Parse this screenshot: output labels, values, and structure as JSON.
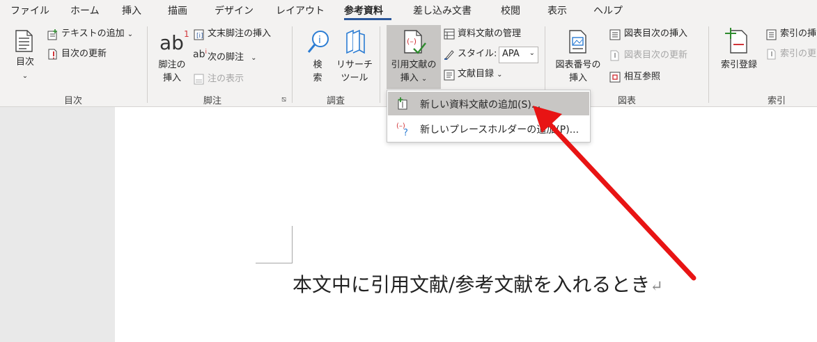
{
  "tabs": [
    "ファイル",
    "ホーム",
    "挿入",
    "描画",
    "デザイン",
    "レイアウト",
    "参考資料",
    "差し込み文書",
    "校閲",
    "表示",
    "ヘルプ"
  ],
  "active_tab": "参考資料",
  "ribbon": {
    "toc": {
      "big_button": "目次",
      "add_text": "テキストの追加",
      "update_toc": "目次の更新",
      "group_label": "目次"
    },
    "footnotes": {
      "insert_footnote_line1": "脚注の",
      "insert_footnote_line2": "挿入",
      "ab_glyph": "ab",
      "superscript": "1",
      "insert_endnote": "文末脚注の挿入",
      "next_footnote": "次の脚注",
      "show_notes": "注の表示",
      "group_label": "脚注"
    },
    "research": {
      "search_line1": "検",
      "search_line2": "索",
      "researcher_line1": "リサーチ",
      "researcher_line2": "ツール",
      "group_label": "調査"
    },
    "citations": {
      "insert_citation_line1": "引用文献の",
      "insert_citation_line2": "挿入",
      "manage_sources": "資料文献の管理",
      "style_label": "スタイル:",
      "style_value": "APA",
      "bibliography": "文献目録"
    },
    "captions": {
      "insert_caption_line1": "図表番号の",
      "insert_caption_line2": "挿入",
      "insert_table_of_figures": "図表目次の挿入",
      "update_table": "図表目次の更新",
      "cross_reference": "相互参照",
      "group_label": "図表"
    },
    "index": {
      "mark_entry": "索引登録",
      "insert_index": "索引の挿",
      "update_index": "索引の更",
      "group_label": "索引"
    }
  },
  "dropdown": {
    "items": [
      "新しい資料文献の追加(S)...",
      "新しいプレースホルダーの追加(P)..."
    ]
  },
  "document": {
    "text": "本文中に引用文献/参考文献を入れるとき",
    "paragraph_mark": "↵"
  },
  "colors": {
    "accent": "#2b579a",
    "arrow": "#e81414",
    "ribbon_bg": "#f3f2f1",
    "highlight": "#c8c6c4"
  }
}
